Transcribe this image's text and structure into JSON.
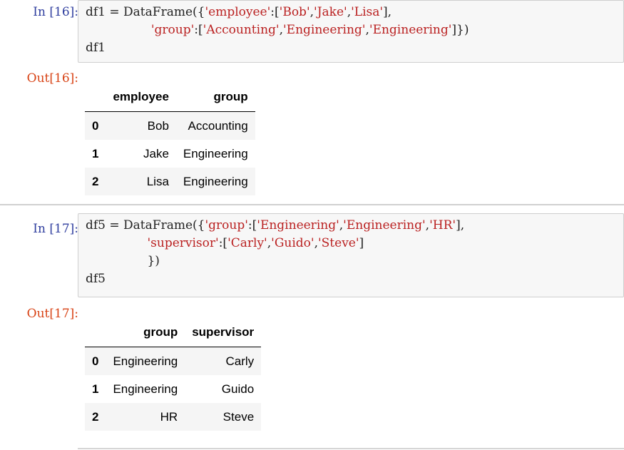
{
  "cells": [
    {
      "in_prompt": "In [16]:",
      "code": {
        "l1_a": "df1 = DataFrame({",
        "l1_s1": "'employee'",
        "l1_b": ":[",
        "l1_s2": "'Bob'",
        "l1_c": ",",
        "l1_s3": "'Jake'",
        "l1_d": ",",
        "l1_s4": "'Lisa'",
        "l1_e": "],",
        "l2_indent": "                 ",
        "l2_s1": "'group'",
        "l2_b": ":[",
        "l2_s2": "'Accounting'",
        "l2_c": ",",
        "l2_s3": "'Engineering'",
        "l2_d": ",",
        "l2_s4": "'Engineering'",
        "l2_e": "]})",
        "l3": "df1"
      },
      "out_prompt": "Out[16]:",
      "table": {
        "columns": [
          "",
          "employee",
          "group"
        ],
        "rows": [
          [
            "0",
            "Bob",
            "Accounting"
          ],
          [
            "1",
            "Jake",
            "Engineering"
          ],
          [
            "2",
            "Lisa",
            "Engineering"
          ]
        ]
      }
    },
    {
      "in_prompt": "In [17]:",
      "code": {
        "l1_a": "df5 = DataFrame({",
        "l1_s1": "'group'",
        "l1_b": ":[",
        "l1_s2": "'Engineering'",
        "l1_c": ",",
        "l1_s3": "'Engineering'",
        "l1_d": ",",
        "l1_s4": "'HR'",
        "l1_e": "],",
        "l2_indent": "                ",
        "l2_s1": "'supervisor'",
        "l2_b": ":[",
        "l2_s2": "'Carly'",
        "l2_c": ",",
        "l2_s3": "'Guido'",
        "l2_d": ",",
        "l2_s4": "'Steve'",
        "l2_e": "]",
        "l3_indent": "                ",
        "l3": "})",
        "l4": "df5"
      },
      "out_prompt": "Out[17]:",
      "table": {
        "columns": [
          "",
          "group",
          "supervisor"
        ],
        "rows": [
          [
            "0",
            "Engineering",
            "Carly"
          ],
          [
            "1",
            "Engineering",
            "Guido"
          ],
          [
            "2",
            "HR",
            "Steve"
          ]
        ]
      }
    }
  ]
}
